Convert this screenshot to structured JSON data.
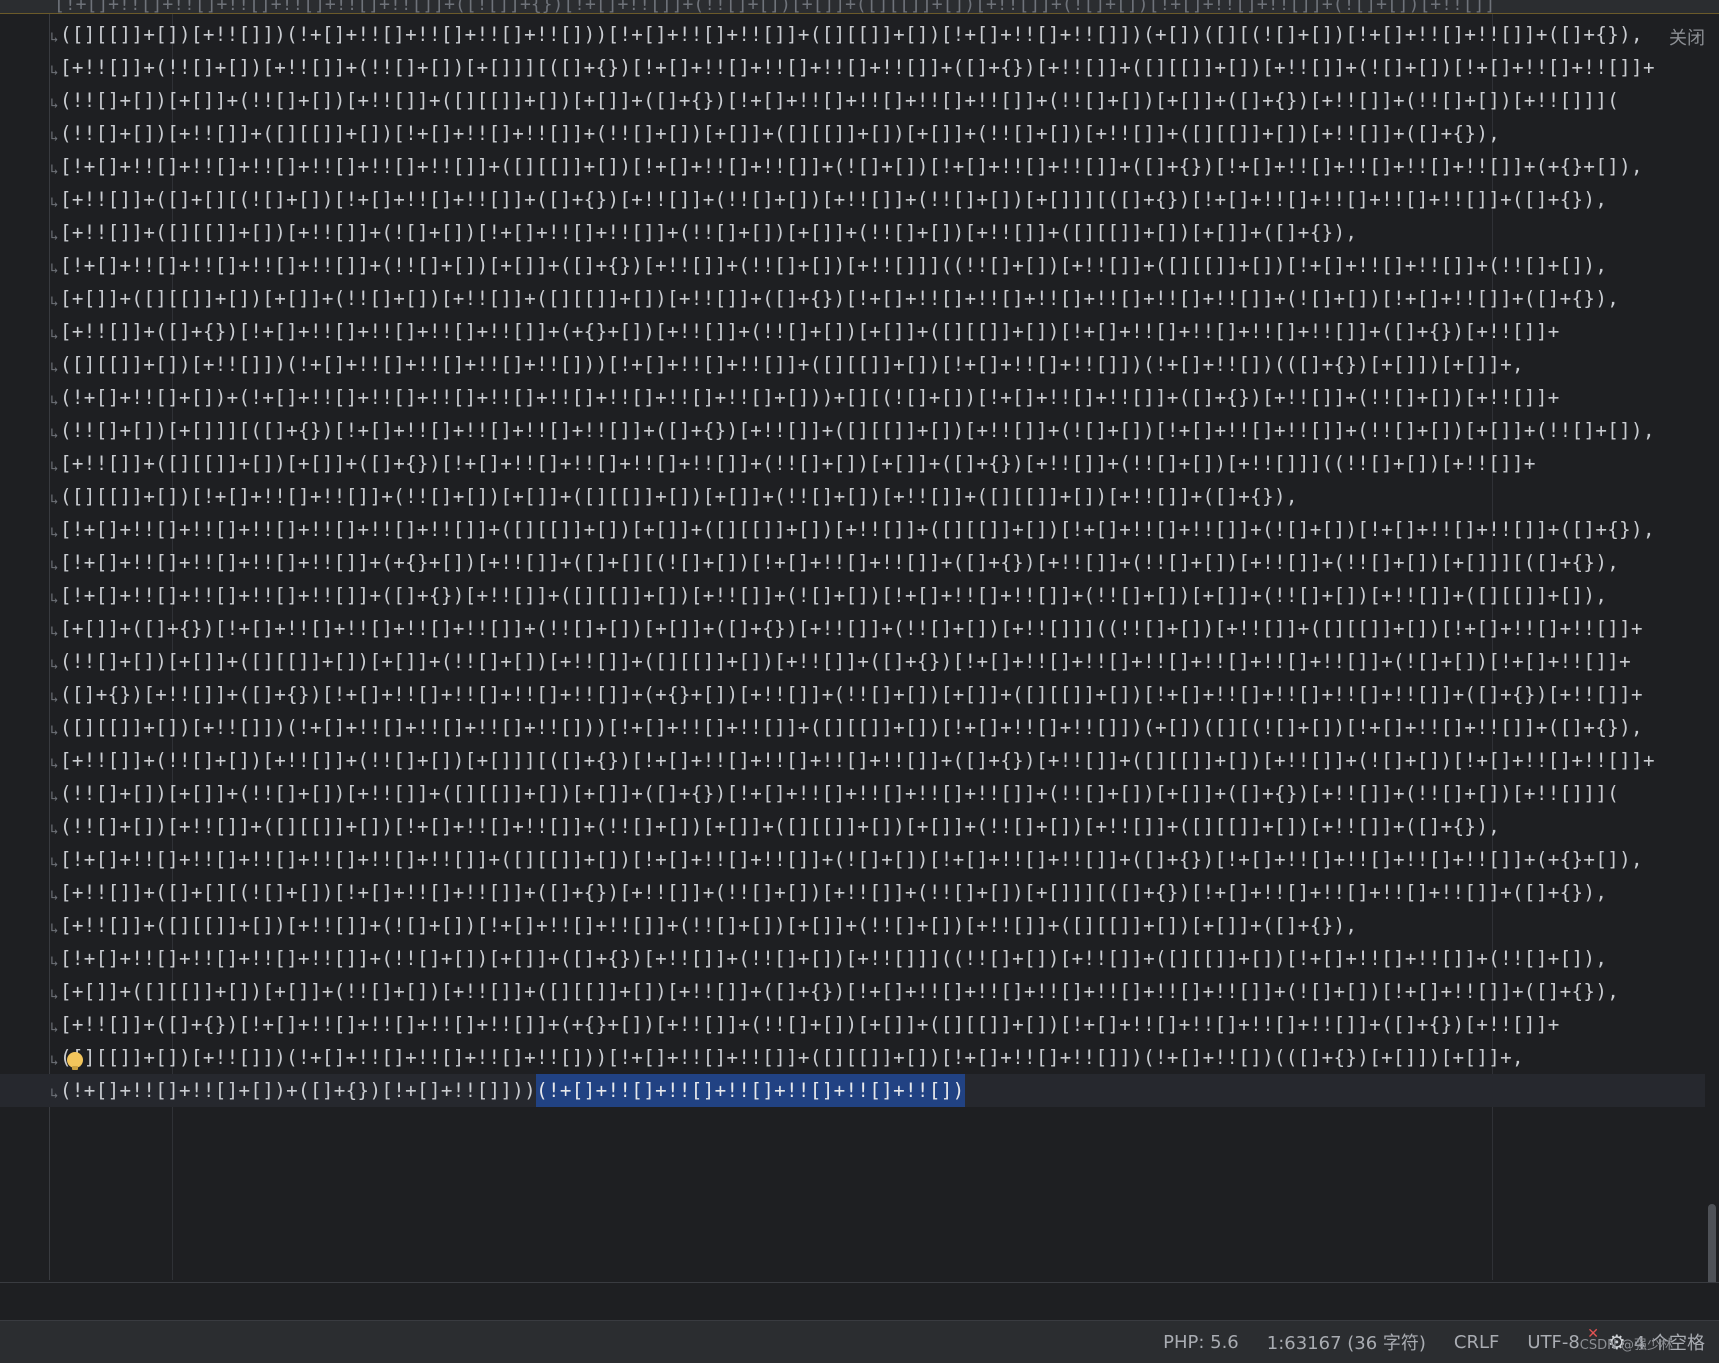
{
  "editor": {
    "close_label": "关闭",
    "top_partial_line": "[!+[]+!![]+!![]+!![]+!![]+!![]+!![]]+([![]]+{})[!+[]+!![]]+(!![]+[])[+[]]+([][[]]+[])[+!![]]+(![]+[])[!+[]+!![]+!![]]+(![]+[])[+!![]]",
    "lines": [
      "([][[]]+[])[+!![]])(!+[]+!![]+!![]+!![]+!![]))[!+[]+!![]+!![]]+([][[]]+[])[!+[]+!![]+!![]])(+[])([][(![]+[])[!+[]+!![]+!![]]+([]+{}),",
      "[+!![]]+(!![]+[])[+!![]]+(!![]+[])[+[]]][([]+{})[!+[]+!![]+!![]+!![]+!![]]+([]+{})[+!![]]+([][[]]+[])[+!![]]+(![]+[])[!+[]+!![]+!![]]+",
      "(!![]+[])[+[]]+(!![]+[])[+!![]]+([][[]]+[])[+[]]+([]+{})[!+[]+!![]+!![]+!![]+!![]]+(!![]+[])[+[]]+([]+{})[+!![]]+(!![]+[])[+!![]]](",
      "(!![]+[])[+!![]]+([][[]]+[])[!+[]+!![]+!![]]+(!![]+[])[+[]]+([][[]]+[])[+[]]+(!![]+[])[+!![]]+([][[]]+[])[+!![]]+([]+{}),",
      "[!+[]+!![]+!![]+!![]+!![]+!![]+!![]]+([][[]]+[])[!+[]+!![]+!![]]+(![]+[])[!+[]+!![]+!![]]+([]+{})[!+[]+!![]+!![]+!![]+!![]]+(+{}+[]),",
      "[+!![]]+([]+[][(![]+[])[!+[]+!![]+!![]]+([]+{})[+!![]]+(!![]+[])[+!![]]+(!![]+[])[+[]]][([]+{})[!+[]+!![]+!![]+!![]+!![]]+([]+{}),",
      "[+!![]]+([][[]]+[])[+!![]]+(![]+[])[!+[]+!![]+!![]]+(!![]+[])[+[]]+(!![]+[])[+!![]]+([][[]]+[])[+[]]+([]+{}),",
      "[!+[]+!![]+!![]+!![]+!![]]+(!![]+[])[+[]]+([]+{})[+!![]]+(!![]+[])[+!![]]]((!![]+[])[+!![]]+([][[]]+[])[!+[]+!![]+!![]]+(!![]+[]),",
      "[+[]]+([][[]]+[])[+[]]+(!![]+[])[+!![]]+([][[]]+[])[+!![]]+([]+{})[!+[]+!![]+!![]+!![]+!![]+!![]+!![]]+(![]+[])[!+[]+!![]]+([]+{}),",
      "[+!![]]+([]+{})[!+[]+!![]+!![]+!![]+!![]]+(+{}+[])[+!![]]+(!![]+[])[+[]]+([][[]]+[])[!+[]+!![]+!![]+!![]+!![]]+([]+{})[+!![]]+",
      "([][[]]+[])[+!![]])(!+[]+!![]+!![]+!![]+!![]))[!+[]+!![]+!![]]+([][[]]+[])[!+[]+!![]+!![]])(!+[]+!![])(([]+{})[+[]])[+[]]+,",
      "(!+[]+!![]+[])+(!+[]+!![]+!![]+!![]+!![]+!![]+!![]+!![]+!![]+[]))+[][(![]+[])[!+[]+!![]+!![]]+([]+{})[+!![]]+(!![]+[])[+!![]]+",
      "(!![]+[])[+[]]][([]+{})[!+[]+!![]+!![]+!![]+!![]]+([]+{})[+!![]]+([][[]]+[])[+!![]]+(![]+[])[!+[]+!![]+!![]]+(!![]+[])[+[]]+(!![]+[]),",
      "[+!![]]+([][[]]+[])[+[]]+([]+{})[!+[]+!![]+!![]+!![]+!![]]+(!![]+[])[+[]]+([]+{})[+!![]]+(!![]+[])[+!![]]]((!![]+[])[+!![]]+",
      "([][[]]+[])[!+[]+!![]+!![]]+(!![]+[])[+[]]+([][[]]+[])[+[]]+(!![]+[])[+!![]]+([][[]]+[])[+!![]]+([]+{}),",
      "[!+[]+!![]+!![]+!![]+!![]+!![]+!![]]+([][[]]+[])[+[]]+([][[]]+[])[+!![]]+([][[]]+[])[!+[]+!![]+!![]]+(![]+[])[!+[]+!![]+!![]]+([]+{}),",
      "[!+[]+!![]+!![]+!![]+!![]]+(+{}+[])[+!![]]+([]+[][(![]+[])[!+[]+!![]+!![]]+([]+{})[+!![]]+(!![]+[])[+!![]]+(!![]+[])[+[]]][([]+{}),",
      "[!+[]+!![]+!![]+!![]+!![]]+([]+{})[+!![]]+([][[]]+[])[+!![]]+(![]+[])[!+[]+!![]+!![]]+(!![]+[])[+[]]+(!![]+[])[+!![]]+([][[]]+[]),",
      "[+[]]+([]+{})[!+[]+!![]+!![]+!![]+!![]]+(!![]+[])[+[]]+([]+{})[+!![]]+(!![]+[])[+!![]]]((!![]+[])[+!![]]+([][[]]+[])[!+[]+!![]+!![]]+",
      "(!![]+[])[+[]]+([][[]]+[])[+[]]+(!![]+[])[+!![]]+([][[]]+[])[+!![]]+([]+{})[!+[]+!![]+!![]+!![]+!![]+!![]+!![]]+(![]+[])[!+[]+!![]]+",
      "([]+{})[+!![]]+([]+{})[!+[]+!![]+!![]+!![]+!![]]+(+{}+[])[+!![]]+(!![]+[])[+[]]+([][[]]+[])[!+[]+!![]+!![]+!![]+!![]]+([]+{})[+!![]]+",
      "([][[]]+[])[+!![]])(!+[]+!![]+!![]+!![]+!![]))[!+[]+!![]+!![]]+([][[]]+[])[!+[]+!![]+!![]])(+[])([][(![]+[])[!+[]+!![]+!![]]+([]+{}),",
      "[+!![]]+(!![]+[])[+!![]]+(!![]+[])[+[]]][([]+{})[!+[]+!![]+!![]+!![]+!![]]+([]+{})[+!![]]+([][[]]+[])[+!![]]+(![]+[])[!+[]+!![]+!![]]+",
      "(!![]+[])[+[]]+(!![]+[])[+!![]]+([][[]]+[])[+[]]+([]+{})[!+[]+!![]+!![]+!![]+!![]]+(!![]+[])[+[]]+([]+{})[+!![]]+(!![]+[])[+!![]]](",
      "(!![]+[])[+!![]]+([][[]]+[])[!+[]+!![]+!![]]+(!![]+[])[+[]]+([][[]]+[])[+[]]+(!![]+[])[+!![]]+([][[]]+[])[+!![]]+([]+{}),",
      "[!+[]+!![]+!![]+!![]+!![]+!![]+!![]]+([][[]]+[])[!+[]+!![]+!![]]+(![]+[])[!+[]+!![]+!![]]+([]+{})[!+[]+!![]+!![]+!![]+!![]]+(+{}+[]),",
      "[+!![]]+([]+[][(![]+[])[!+[]+!![]+!![]]+([]+{})[+!![]]+(!![]+[])[+!![]]+(!![]+[])[+[]]][([]+{})[!+[]+!![]+!![]+!![]+!![]]+([]+{}),",
      "[+!![]]+([][[]]+[])[+!![]]+(![]+[])[!+[]+!![]+!![]]+(!![]+[])[+[]]+(!![]+[])[+!![]]+([][[]]+[])[+[]]+([]+{}),",
      "[!+[]+!![]+!![]+!![]+!![]]+(!![]+[])[+[]]+([]+{})[+!![]]+(!![]+[])[+!![]]]((!![]+[])[+!![]]+([][[]]+[])[!+[]+!![]+!![]]+(!![]+[]),",
      "[+[]]+([][[]]+[])[+[]]+(!![]+[])[+!![]]+([][[]]+[])[+!![]]+([]+{})[!+[]+!![]+!![]+!![]+!![]+!![]+!![]]+(![]+[])[!+[]+!![]]+([]+{}),",
      "[+!![]]+([]+{})[!+[]+!![]+!![]+!![]+!![]]+(+{}+[])[+!![]]+(!![]+[])[+[]]+([][[]]+[])[!+[]+!![]+!![]+!![]+!![]]+([]+{})[+!![]]+",
      "([][[]]+[])[+!![]])(!+[]+!![]+!![]+!![]+!![]))[!+[]+!![]+!![]]+([][[]]+[])[!+[]+!![]+!![]])(!+[]+!![])(([]+{})[+[]])[+[]]+,"
    ],
    "last_line": {
      "text": "(!+[]+!![]+!![]+[])+([]+{})[!+[]+!![]]))",
      "selected": "(!+[]+!![]+!![]+!![]+!![]+!![]+!![])"
    }
  },
  "status_bar": {
    "language": "PHP: 5.6",
    "position": "1:63167 (36 字符)",
    "line_ending": "CRLF",
    "encoding": "UTF-8",
    "indent": "4 个空格"
  },
  "watermark": "CSDN @强少林"
}
